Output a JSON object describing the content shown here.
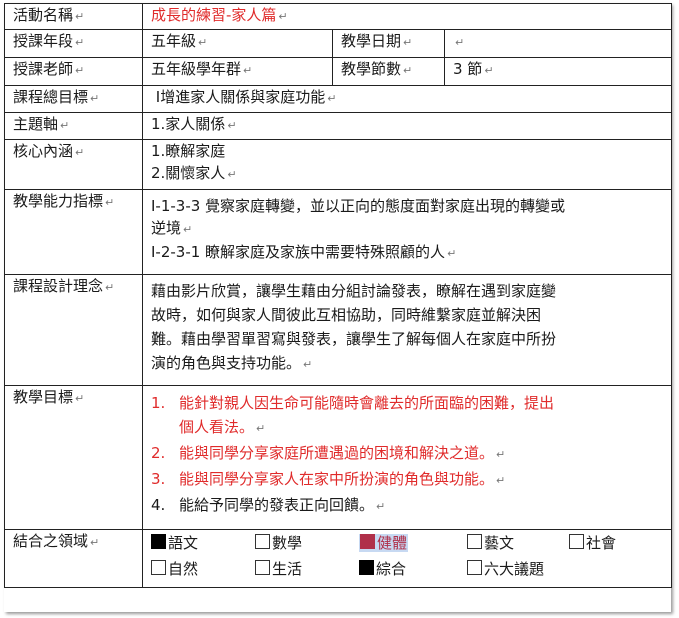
{
  "rows": {
    "activity": {
      "label": "活動名稱",
      "value": "成長的練習-家人篇"
    },
    "grade": {
      "label": "授課年段",
      "value": "五年級",
      "label2": "教學日期",
      "value2": ""
    },
    "teacher": {
      "label": "授課老師",
      "value": "五年級學年群",
      "label2": "教學節數",
      "value2": "3 節"
    },
    "overall_goal": {
      "label": "課程總目標",
      "value": "Ⅰ增進家人關係與家庭功能"
    },
    "theme": {
      "label": "主題軸",
      "value": "1.家人關係"
    },
    "core": {
      "label": "核心內涵",
      "lines": [
        "1.瞭解家庭",
        "2.關懷家人"
      ]
    },
    "ability": {
      "label": "教學能力指標",
      "lines": [
        "I-1-3-3 覺察家庭轉變，並以正向的態度面對家庭出現的轉變或",
        "逆境",
        "I-2-3-1 瞭解家庭及家族中需要特殊照顧的人"
      ]
    },
    "design": {
      "label": "課程設計理念",
      "lines": [
        "藉由影片欣賞，讓學生藉由分組討論發表，瞭解在遇到家庭變",
        "故時，如何與家人間彼此互相協助，同時維繫家庭並解決困",
        "難。藉由學習單習寫與發表，讓學生了解每個人在家庭中所扮",
        "演的角色與支持功能。"
      ]
    },
    "objectives": {
      "label": "教學目標",
      "items": [
        {
          "num": "1.",
          "lines": [
            "能針對親人因生命可能隨時會離去的所面臨的困難，提出",
            "個人看法。"
          ]
        },
        {
          "num": "2.",
          "lines": [
            "能與同學分享家庭所遭遇過的困境和解決之道。"
          ]
        },
        {
          "num": "3.",
          "lines": [
            "能與同學分享家人在家中所扮演的角色與功能。"
          ]
        },
        {
          "num": "4.",
          "lines": [
            "能給予同學的發表正向回饋。"
          ]
        }
      ]
    },
    "domains": {
      "label": "結合之領域",
      "items": [
        {
          "name": "語文",
          "checked": true
        },
        {
          "name": "數學",
          "checked": false
        },
        {
          "name": "健體",
          "checked": true
        },
        {
          "name": "藝文",
          "checked": false
        },
        {
          "name": "社會",
          "checked": false
        },
        {
          "name": "自然",
          "checked": false
        },
        {
          "name": "生活",
          "checked": false
        },
        {
          "name": "綜合",
          "checked": true
        },
        {
          "name": "六大議題",
          "checked": false
        }
      ]
    }
  },
  "colors": {
    "objective_red": "#e02b2b",
    "highlight": "#c7d9f2",
    "checkbox_red": "#b0304a"
  },
  "icons": {
    "paragraph_mark": "↵"
  }
}
